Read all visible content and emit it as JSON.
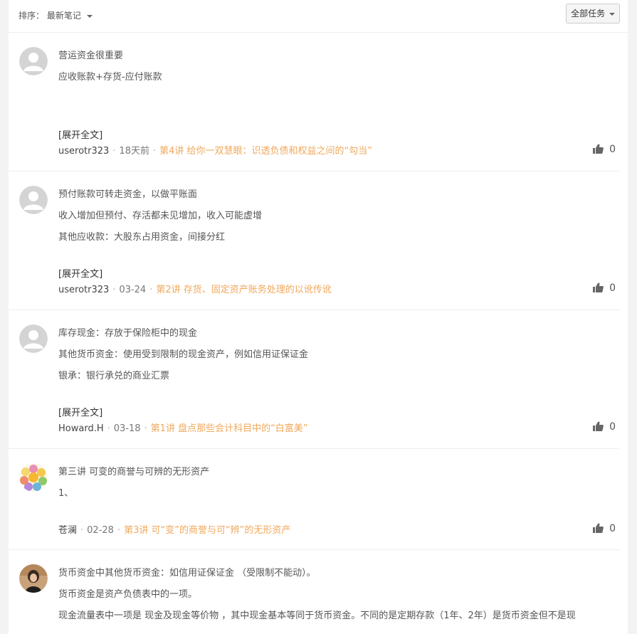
{
  "toolbar": {
    "sort_label": "排序：",
    "sort_value": "最新笔记",
    "task_filter": "全部任务"
  },
  "expand_label": "[展开全文]",
  "notes": [
    {
      "lines": [
        "营运资金很重要",
        "应收账款+存货-应付账款"
      ],
      "author": "userotr323",
      "time": "18天前",
      "lesson": "第4讲 给你一双慧眼：识透负债和权益之间的“勾当”",
      "likes": "0",
      "avatar": "default-avatar"
    },
    {
      "lines": [
        "预付账款可转走资金，以做平账面",
        "收入增加但预付、存活都未见增加，收入可能虚增",
        "其他应收款：大股东占用资金，间接分红"
      ],
      "author": "userotr323",
      "time": "03-24",
      "lesson": "第2讲 存货、固定资产账务处理的以讹传讹",
      "likes": "0",
      "avatar": "default-avatar"
    },
    {
      "lines": [
        "库存现金：存放于保险柜中的现金",
        "其他货币资金：使用受到限制的现金资产，例如信用证保证金",
        "银承：银行承兑的商业汇票"
      ],
      "author": "Howard.H",
      "time": "03-18",
      "lesson": "第1讲 盘点那些会计科目中的“白富美”",
      "likes": "0",
      "avatar": "default-avatar"
    },
    {
      "lines": [
        "第三讲 可变的商誉与可辨的无形资产",
        "1、"
      ],
      "author": "苍澜",
      "time": "02-28",
      "lesson": "第3讲 可“变”的商誉与可“辨”的无形资产",
      "likes": "0",
      "avatar": "flower-avatar"
    },
    {
      "lines": [
        "货币资金中其他货币资金：如信用证保证金 （受限制不能动）。",
        "货币资金是资产负债表中的一项。",
        "现金流量表中一项是 现金及现金等价物 ，其中现金基本等同于货币资金。不同的是定期存款（1年、2年）是货币资金但不是现"
      ],
      "author": "",
      "time": "",
      "lesson": "",
      "likes": "",
      "avatar": "photo-avatar"
    }
  ],
  "colors": {
    "lesson_link": "#f0a85c",
    "divider": "#eeeeee"
  }
}
